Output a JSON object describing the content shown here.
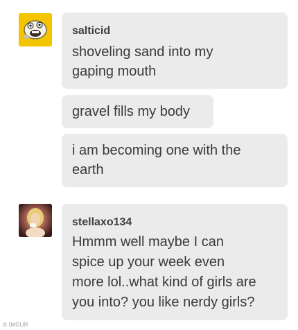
{
  "messages": [
    {
      "username": "salticid",
      "bubbles": [
        "shoveling sand into my\ngaping mouth",
        "gravel fills my body",
        "i am becoming one with the\nearth"
      ]
    },
    {
      "username": "stellaxo134",
      "bubbles": [
        "Hmmm well maybe I can\nspice up your week even\nmore lol..what kind of girls are\nyou into? you like nerdy girls?"
      ]
    }
  ],
  "watermark": "© IMGUR",
  "colors": {
    "bubble_bg": "#ebebeb",
    "text": "#3a3a3a",
    "avatar1_bg": "#f2c400"
  },
  "icons": {
    "avatar1": "cartoon-face-avatar",
    "avatar2": "profile-photo-avatar"
  }
}
